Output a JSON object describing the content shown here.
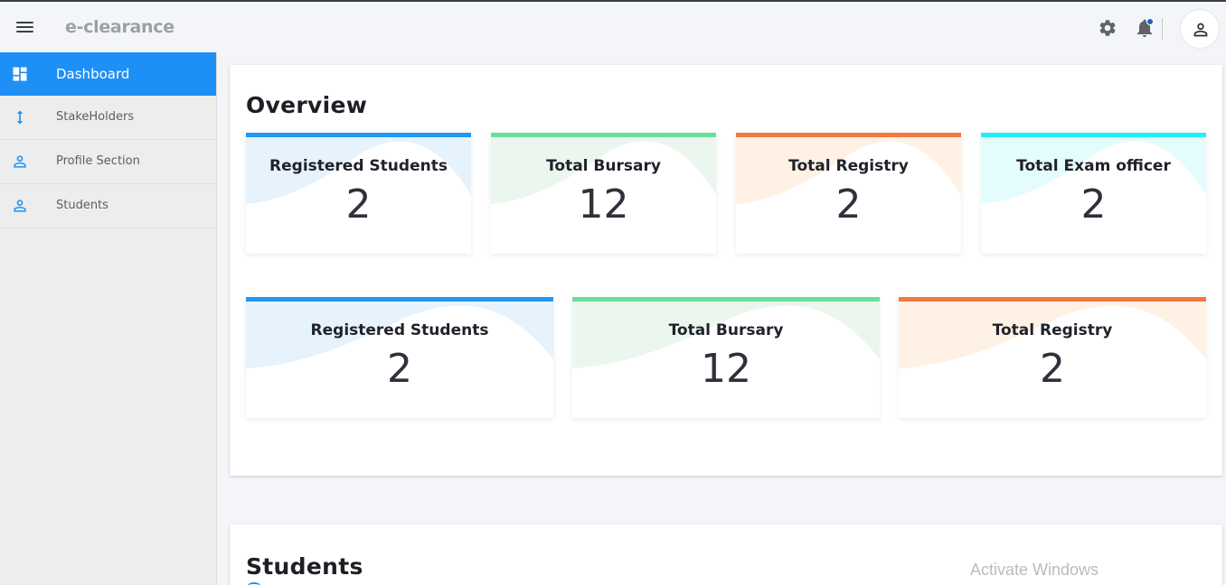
{
  "app": {
    "title": "e-clearance"
  },
  "topbar": {
    "menu_icon": "hamburger-icon",
    "settings_icon": "gear-icon",
    "notifications_icon": "bell-icon",
    "profile_icon": "user-icon",
    "notification_dot_color": "#1565c0"
  },
  "sidebar": {
    "items": [
      {
        "label": "Dashboard",
        "icon": "dashboard-icon",
        "active": true
      },
      {
        "label": "StakeHolders",
        "icon": "vertical-arrows-icon",
        "active": false
      },
      {
        "label": "Profile Section",
        "icon": "user-icon",
        "active": false
      },
      {
        "label": "Students",
        "icon": "user-icon",
        "active": false
      }
    ],
    "accent_color": "#1e90f5"
  },
  "overview": {
    "title": "Overview",
    "row1": [
      {
        "title": "Registered Students",
        "value": "2",
        "accent": "#2196f3",
        "tint": "#e6f2fc"
      },
      {
        "title": "Total Bursary",
        "value": "12",
        "accent": "#69e09a",
        "tint": "#ebf7ee"
      },
      {
        "title": "Total Registry",
        "value": "2",
        "accent": "#f4773f",
        "tint": "#fff1e3"
      },
      {
        "title": "Total Exam officer",
        "value": "2",
        "accent": "#22f0f4",
        "tint": "#e4fcfc"
      }
    ],
    "row2": [
      {
        "title": "Registered Students",
        "value": "2",
        "accent": "#2196f3",
        "tint": "#e6f2fc"
      },
      {
        "title": "Total Bursary",
        "value": "12",
        "accent": "#69e09a",
        "tint": "#ebf7ee"
      },
      {
        "title": "Total Registry",
        "value": "2",
        "accent": "#f4773f",
        "tint": "#fff1e3"
      }
    ]
  },
  "students": {
    "title": "Students"
  },
  "watermark": {
    "text": "Activate Windows"
  }
}
